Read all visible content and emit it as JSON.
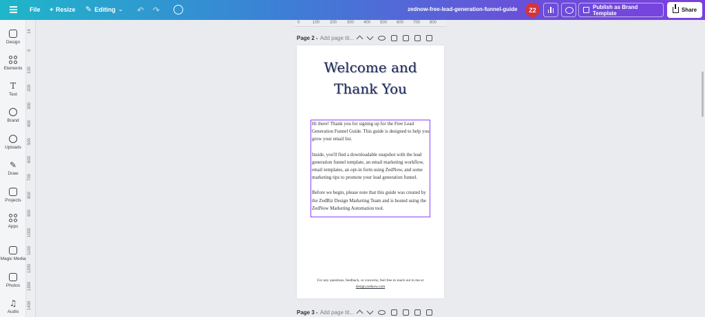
{
  "topbar": {
    "file_label": "File",
    "resize_label": "Resize",
    "editing_label": "Editing",
    "doc_title": "zednow-free-lead-generation-funnel-guide",
    "avatar_initials": "Z2",
    "publish_label": "Publish as Brand Template",
    "share_label": "Share"
  },
  "sidebar": {
    "items": [
      {
        "label": "Design",
        "icon": "design-icon"
      },
      {
        "label": "Elements",
        "icon": "elements-icon"
      },
      {
        "label": "Text",
        "icon": "text-icon"
      },
      {
        "label": "Brand",
        "icon": "brand-icon"
      },
      {
        "label": "Uploads",
        "icon": "uploads-icon"
      },
      {
        "label": "Draw",
        "icon": "draw-icon"
      },
      {
        "label": "Projects",
        "icon": "projects-icon"
      },
      {
        "label": "Apps",
        "icon": "apps-icon"
      },
      {
        "label": "Magic Media",
        "icon": "magic-media-icon"
      },
      {
        "label": "Photos",
        "icon": "photos-icon"
      },
      {
        "label": "Audio",
        "icon": "audio-icon"
      }
    ]
  },
  "vertical_ruler": [
    "14",
    "0",
    "100",
    "200",
    "300",
    "400",
    "500",
    "600",
    "700",
    "800",
    "900",
    "1000",
    "1100",
    "1200",
    "1300",
    "1400"
  ],
  "horizontal_ruler": [
    "0",
    "100",
    "200",
    "300",
    "400",
    "500",
    "600",
    "700",
    "800"
  ],
  "page2": {
    "number_label": "Page 2 -",
    "title_placeholder": "Add page tit...",
    "title_line1": "Welcome and",
    "title_line2": "Thank You",
    "paragraph1": "Hi there! Thank you for signing up for the Free Lead Generation Funnel Guide. This guide is designed to help you grow your email list.",
    "paragraph2": "Inside, you'll find a downloadable snapshot with the lead generation funnel template, an email marketing workflow, email templates, an opt-in form using ZedNow, and some marketing tips to promote your lead generation funnel.",
    "paragraph3": "Before we begin, please note that this guide was created by the ZedBiz Design Marketing Team and is hosted using the ZedNow Marketing Automation tool.",
    "footer_line": "For any questions, feedback, or concerns, feel free to reach out to me at",
    "footer_link": "design.zednow.com"
  },
  "page3": {
    "number_label": "Page 3 -",
    "title_placeholder": "Add page tit..."
  },
  "colors": {
    "selection": "#8b3dff",
    "title": "#1b2a5a",
    "avatar": "#d4343d"
  }
}
